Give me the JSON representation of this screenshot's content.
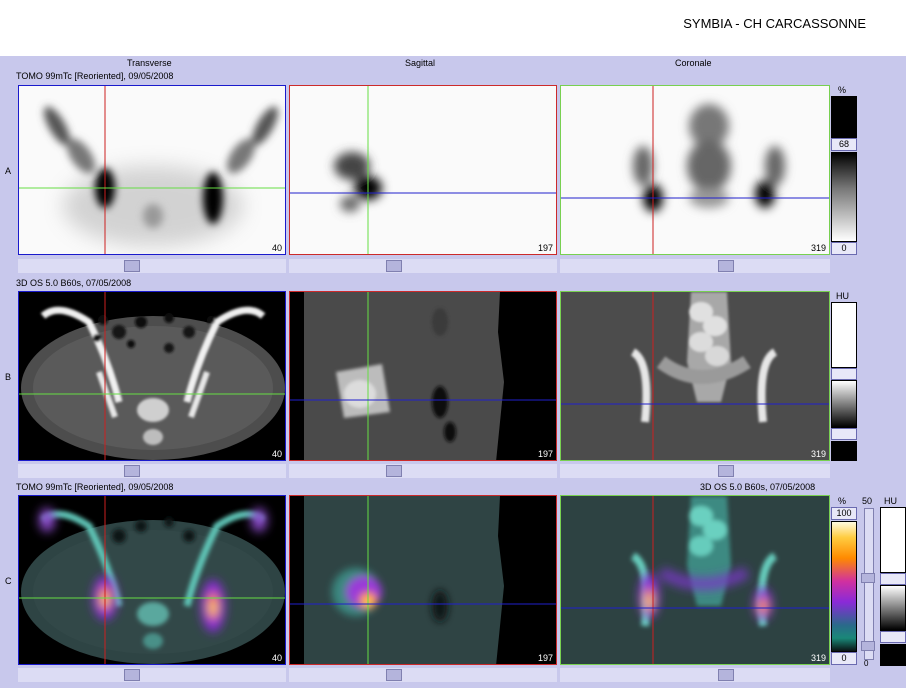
{
  "app": {
    "title": "SYMBIA - CH CARCASSONNE"
  },
  "columns": [
    "Transverse",
    "Sagittal",
    "Coronale"
  ],
  "rows": [
    {
      "label": "A",
      "series_left": "TOMO 99mTc [Reoriented], 09/05/2008",
      "series_right": "",
      "slices": [
        "40",
        "197",
        "319"
      ]
    },
    {
      "label": "B",
      "series_left": "3D  OS  5.0  B60s, 07/05/2008",
      "series_right": "",
      "slices": [
        "40",
        "197",
        "319"
      ]
    },
    {
      "label": "C",
      "series_left": "TOMO 99mTc [Reoriented], 09/05/2008",
      "series_right": "3D  OS  5.0  B60s, 07/05/2008",
      "slices": [
        "40",
        "197",
        "319"
      ]
    }
  ],
  "scales": {
    "a": {
      "unit": "%",
      "level": "68",
      "min": "0"
    },
    "b": {
      "unit": "HU"
    },
    "c_pet": {
      "unit": "%",
      "max": "100",
      "min": "0"
    },
    "c_window": {
      "max": "50",
      "min": "0"
    },
    "c_ct": {
      "unit": "HU"
    }
  },
  "colors": {
    "transverse_border": "#1a1acc",
    "sagittal_border": "#cc2a2a",
    "coronal_border": "#78d050",
    "red_crosshair": "#cc2020",
    "green_crosshair": "#66dd44",
    "blue_crosshair": "#2020cc",
    "workspace_bg": "#c8c8ec"
  }
}
